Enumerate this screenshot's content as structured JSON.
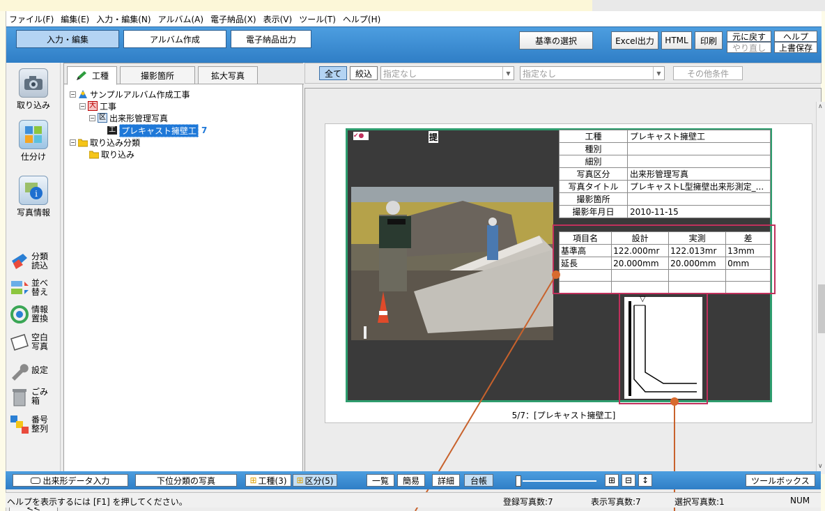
{
  "menu": [
    "ファイル(F)",
    "編集(E)",
    "入力・編集(N)",
    "アルバム(A)",
    "電子納品(X)",
    "表示(V)",
    "ツール(T)",
    "ヘルプ(H)"
  ],
  "main_tabs": [
    "入力・編集",
    "アルバム作成",
    "電子納品出力"
  ],
  "toolbar": {
    "kijun": "基準の選択",
    "excel": "Excel出力",
    "html": "HTML",
    "print": "印刷",
    "undo": "元に戻す",
    "redo": "やり直し",
    "help": "ヘルプ",
    "save": "上書保存"
  },
  "left_tools": {
    "import": "取り込み",
    "sort": "仕分け",
    "photo_info": "写真情報",
    "class_read": "分類\n読込",
    "reorder": "並べ\n替え",
    "info_replace": "情報\n置換",
    "blank_photo": "空白\n写真",
    "settings": "設定",
    "trash": "ごみ\n箱",
    "renumber": "番号\n整列",
    "collapse": "<<"
  },
  "tree_tabs": [
    "工種",
    "撮影箇所",
    "拡大写真"
  ],
  "tree": {
    "root": "サンプルアルバム作成工事",
    "dai_icon": "大",
    "dai": "工事",
    "ku_icon": "区",
    "ku": "出来形管理写真",
    "ko_icon": "工",
    "ko": "プレキャスト擁壁工",
    "ko_count": "7",
    "import_class": "取り込み分類",
    "import": "取り込み"
  },
  "filter": {
    "all": "全て",
    "narrow": "絞込",
    "combo1": "指定なし",
    "combo2": "指定なし",
    "other": "その他条件"
  },
  "card": {
    "stamp": "提",
    "info": [
      [
        "工種",
        "プレキャスト擁壁工"
      ],
      [
        "種別",
        ""
      ],
      [
        "細別",
        ""
      ],
      [
        "写真区分",
        "出来形管理写真"
      ],
      [
        "写真タイトル",
        "プレキャストL型擁壁出来形測定_..."
      ],
      [
        "撮影箇所",
        ""
      ],
      [
        "撮影年月日",
        "2010-11-15"
      ]
    ],
    "meas_header": [
      "項目名",
      "設計",
      "実測",
      "差"
    ],
    "meas_rows": [
      [
        "基準高",
        "122.000mr",
        "122.013mr",
        "13mm"
      ],
      [
        "延長",
        "20.000mm",
        "20.000mm",
        "0mm"
      ],
      [
        "",
        "",
        "",
        ""
      ],
      [
        "",
        "",
        "",
        ""
      ]
    ],
    "diagram_mark": "▽",
    "caption": "5/7：[プレキャスト擁壁工]"
  },
  "bottom": {
    "dekigata": "出来形データ入力",
    "lower": "下位分類の写真",
    "kosyu": "工種(3)",
    "kubun": "区分(5)",
    "list": "一覧",
    "simple": "簡易",
    "detail": "詳細",
    "ledger": "台帳",
    "toolbox": "ツールボックス"
  },
  "status": {
    "help": "ヘルプを表示するには [F1] を押してください。",
    "registered": "登録写真数:7",
    "displayed": "表示写真数:7",
    "selected": "選択写真数:1",
    "num": "NUM"
  },
  "colors": {
    "toolbar": "#3a88cf",
    "highlight": "#c0305c",
    "frame": "#2e9d6e",
    "selected": "#1e78d8"
  }
}
